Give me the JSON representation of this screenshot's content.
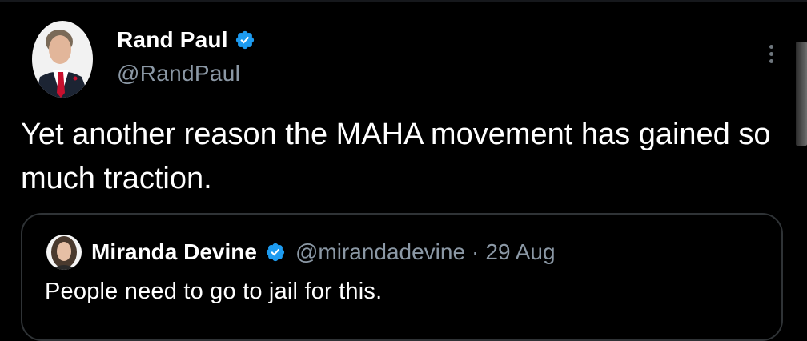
{
  "tweet": {
    "author": {
      "display_name": "Rand Paul",
      "handle": "@RandPaul",
      "verified": true,
      "avatar_icon": "portrait-avatar"
    },
    "text": "Yet another reason the MAHA movement has gained so much traction.",
    "more_icon": "more-vertical-icon"
  },
  "quote": {
    "author": {
      "display_name": "Miranda Devine",
      "handle": "@mirandadevine",
      "verified": true,
      "avatar_icon": "portrait-avatar"
    },
    "separator": "·",
    "date": "29 Aug",
    "text": "People need to go to jail for this."
  },
  "colors": {
    "background": "#000000",
    "primary_text": "#ffffff",
    "secondary_text": "#8b98a5",
    "verified_badge": "#1d9bf0",
    "card_border": "#2f3336"
  }
}
